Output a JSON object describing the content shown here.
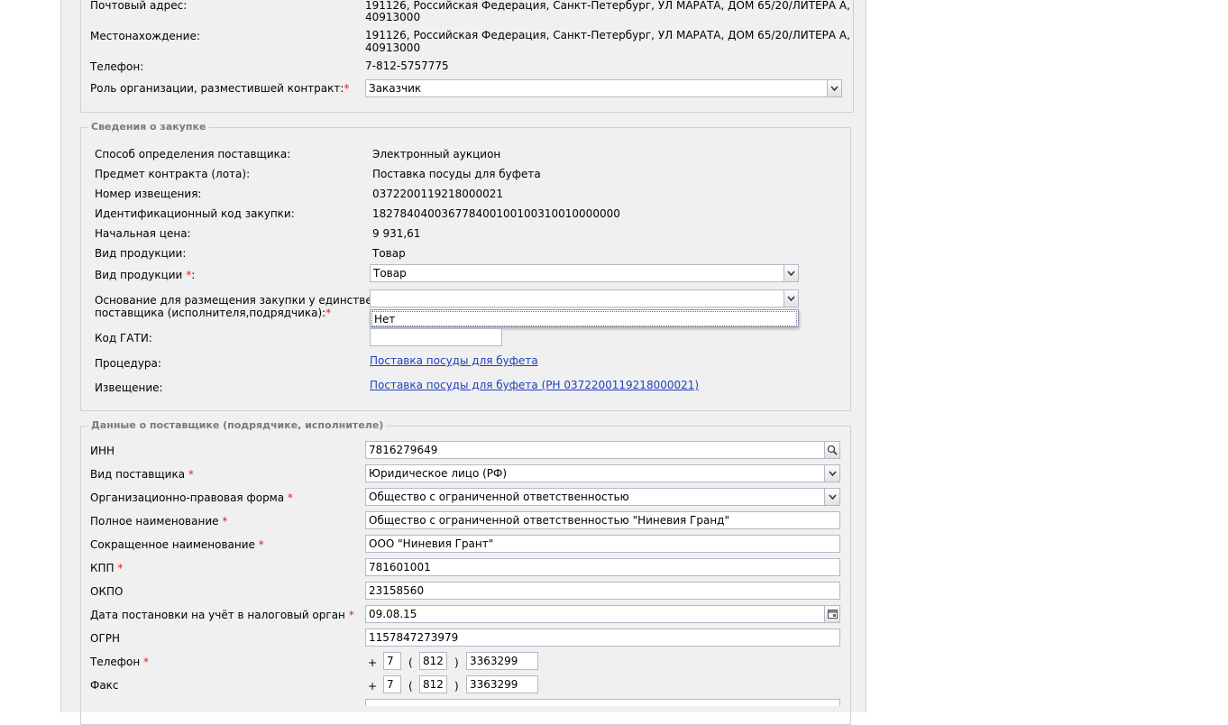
{
  "org": {
    "postal_label": "Почтовый адрес:",
    "postal_value_1": "191126, Российская Федерация, Санкт-Петербург, УЛ МАРАТА, ДОМ 65/20/ЛИТЕРА А,",
    "postal_value_2": "40913000",
    "location_label": "Местонахождение:",
    "location_value_1": "191126, Российская Федерация, Санкт-Петербург, УЛ МАРАТА, ДОМ 65/20/ЛИТЕРА А,",
    "location_value_2": "40913000",
    "phone_label": "Телефон:",
    "phone_value": "7-812-5757775",
    "role_label": "Роль организации, разместившей контракт:",
    "role_value": "Заказчик"
  },
  "purchase": {
    "legend": "Сведения о закупке",
    "method_label": "Способ определения поставщика:",
    "method_value": "Электронный аукцион",
    "subject_label": "Предмет контракта (лота):",
    "subject_value": "Поставка посуды для буфета",
    "notice_no_label": "Номер извещения:",
    "notice_no_value": "0372200119218000021",
    "ikz_label": "Идентификационный код закупки:",
    "ikz_value": "182784040036778400100100310010000000",
    "price_label": "Начальная цена:",
    "price_value": "9 931,61",
    "product_type_label": "Вид продукции:",
    "product_type_value": "Товар",
    "product_type2_label": "Вид продукции",
    "product_type2_value": "Товар",
    "basis_label_1": "Основание для размещения закупки у единственного",
    "basis_label_2": "поставщика (исполнителя,подрядчика):",
    "basis_value": "",
    "basis_option": "Нет",
    "gati_label": "Код ГАТИ:",
    "gati_value": "",
    "procedure_label": "Процедура:",
    "procedure_link": "Поставка посуды для буфета",
    "notice_label": "Извещение:",
    "notice_link": "Поставка посуды для буфета (РН 0372200119218000021)"
  },
  "supplier": {
    "legend": "Данные о поставщике (подрядчике, исполнителе)",
    "inn_label": "ИНН",
    "inn_value": "7816279649",
    "type_label": "Вид поставщика",
    "type_value": "Юридическое лицо (РФ)",
    "opf_label": "Организационно-правовая форма",
    "opf_value": "Общество с ограниченной ответственностью",
    "fullname_label": "Полное наименование",
    "fullname_value": "Общество с ограниченной ответственностью \"Ниневия Гранд\"",
    "shortname_label": "Сокращенное наименование",
    "shortname_value": "ООО \"Ниневия Грант\"",
    "kpp_label": "КПП",
    "kpp_value": "781601001",
    "okpo_label": "ОКПО",
    "okpo_value": "23158560",
    "taxdate_label": "Дата постановки на учёт в налоговый орган",
    "taxdate_value": "09.08.15",
    "ogrn_label": "ОГРН",
    "ogrn_value": "1157847273979",
    "phone_label": "Телефон",
    "phone_country": "7",
    "phone_code": "812",
    "phone_number": "3363299",
    "fax_label": "Факс",
    "fax_country": "7",
    "fax_code": "812",
    "fax_number": "3363299"
  },
  "symbols": {
    "asterisk": "*",
    "colon": ":",
    "plus": "+",
    "lparen": "(",
    "rparen": ")"
  },
  "icons": [
    "chevron-down-icon",
    "search-icon",
    "calendar-icon"
  ],
  "colors": {
    "required": "#e02020",
    "link": "#1f3fbf",
    "panel": "#f0f0f0"
  }
}
